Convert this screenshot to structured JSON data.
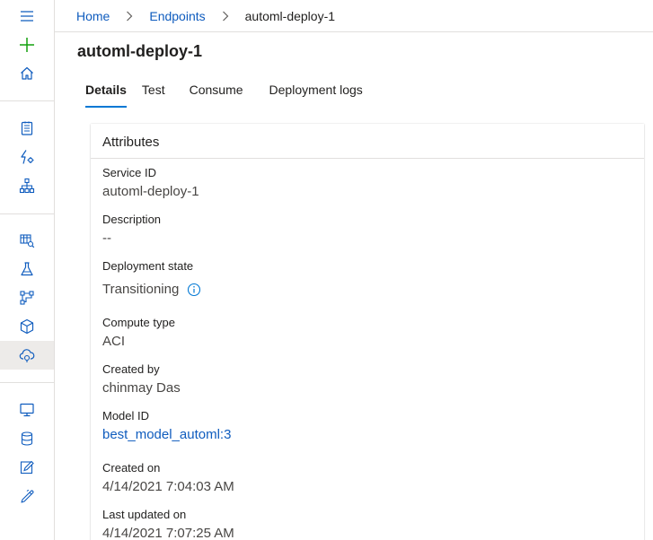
{
  "breadcrumb": {
    "items": [
      {
        "label": "Home"
      },
      {
        "label": "Endpoints"
      },
      {
        "label": "automl-deploy-1"
      }
    ]
  },
  "page": {
    "title": "automl-deploy-1"
  },
  "tabs": [
    {
      "label": "Details",
      "active": true
    },
    {
      "label": "Test",
      "active": false
    },
    {
      "label": "Consume",
      "active": false
    },
    {
      "label": "Deployment logs",
      "active": false
    }
  ],
  "attributes": {
    "title": "Attributes",
    "items": [
      {
        "label": "Service ID",
        "value": "automl-deploy-1"
      },
      {
        "label": "Description",
        "value": "--"
      },
      {
        "label": "Deployment state",
        "value": "Transitioning"
      },
      {
        "label": "Compute type",
        "value": "ACI"
      },
      {
        "label": "Created by",
        "value": "chinmay Das"
      },
      {
        "label": "Model ID",
        "value": "best_model_automl:3"
      },
      {
        "label": "Created on",
        "value": "4/14/2021 7:04:03 AM"
      },
      {
        "label": "Last updated on",
        "value": "4/14/2021 7:07:25 AM"
      }
    ]
  },
  "sidebar": {
    "items": [
      {
        "icon": "hamburger-menu-icon"
      },
      {
        "icon": "plus-icon"
      },
      {
        "icon": "home-icon"
      },
      {
        "icon": "notebook-icon"
      },
      {
        "icon": "automated-ml-icon"
      },
      {
        "icon": "designer-icon"
      },
      {
        "icon": "datasets-icon"
      },
      {
        "icon": "experiments-icon"
      },
      {
        "icon": "pipelines-icon"
      },
      {
        "icon": "models-icon"
      },
      {
        "icon": "endpoints-icon",
        "active": true
      },
      {
        "icon": "compute-icon"
      },
      {
        "icon": "datastores-icon"
      },
      {
        "icon": "data-labeling-icon"
      },
      {
        "icon": "linked-services-icon"
      }
    ]
  },
  "colors": {
    "accent": "#0078d4",
    "link": "#0f5cbe",
    "add_icon": "#13a10e",
    "rail_icon": "#0f5cbe"
  }
}
